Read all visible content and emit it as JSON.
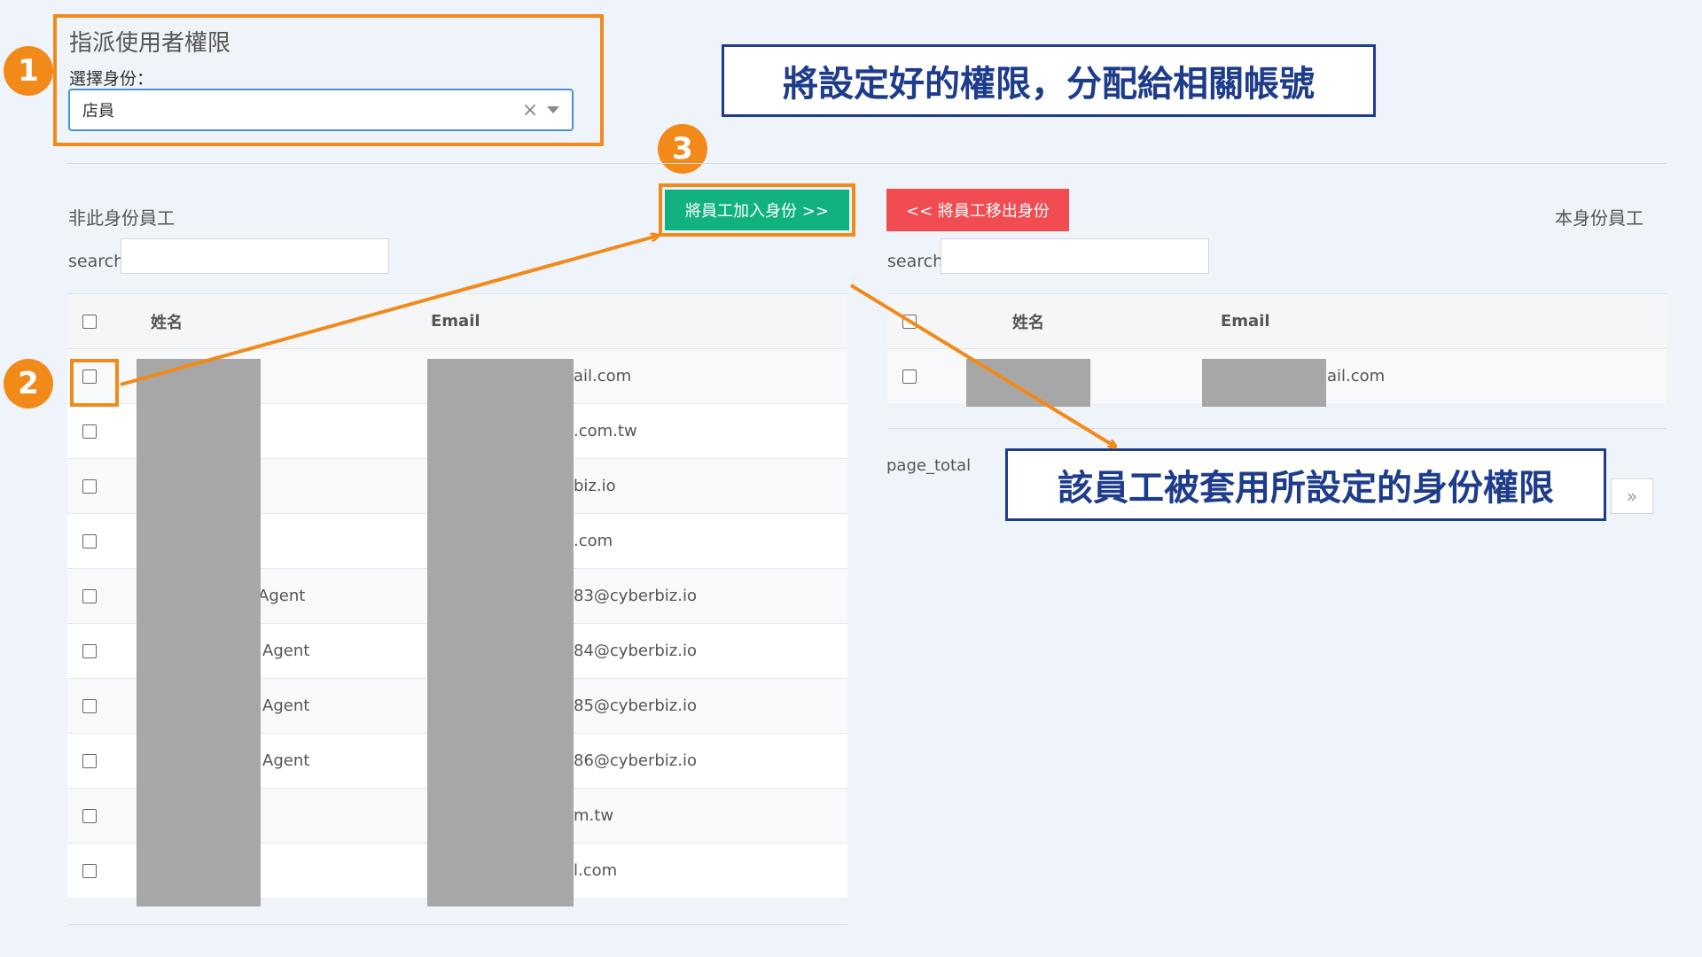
{
  "assign": {
    "title": "指派使用者權限",
    "role_label": "選擇身份：",
    "role_value": "店員",
    "clear_glyph": "×"
  },
  "callouts": {
    "top": "將設定好的權限，分配給相關帳號",
    "bottom": "該員工被套用所設定的身份權限"
  },
  "badges": [
    "1",
    "2",
    "3"
  ],
  "buttons": {
    "add": "將員工加入身份 >>",
    "remove": "<< 將員工移出身份"
  },
  "left_panel": {
    "label": "非此身份員工",
    "search_label": "search",
    "columns": {
      "name": "姓名",
      "email": "Email"
    },
    "rows": [
      {
        "name": "",
        "email": "ail.com"
      },
      {
        "name": "",
        "email": ".com.tw"
      },
      {
        "name": "",
        "email": "biz.io"
      },
      {
        "name": "",
        "email": ".com"
      },
      {
        "name": "Agent",
        "email": "83@cyberbiz.io"
      },
      {
        "name": "Agent",
        "email": "84@cyberbiz.io"
      },
      {
        "name": "Agent",
        "email": "85@cyberbiz.io"
      },
      {
        "name": "Agent",
        "email": "86@cyberbiz.io"
      },
      {
        "name": "",
        "email": "m.tw"
      },
      {
        "name": "",
        "email": "l.com"
      }
    ]
  },
  "right_panel": {
    "label": "本身份員工",
    "search_label": "search",
    "columns": {
      "name": "姓名",
      "email": "Email"
    },
    "rows": [
      {
        "name": "",
        "email": "ail.com"
      }
    ],
    "page_total_label": "page_total",
    "next_glyph": "»"
  },
  "colors": {
    "accent_orange": "#f28a1a",
    "callout_blue": "#1e3c8c",
    "add_green": "#11b27f",
    "remove_red": "#f04c52"
  }
}
